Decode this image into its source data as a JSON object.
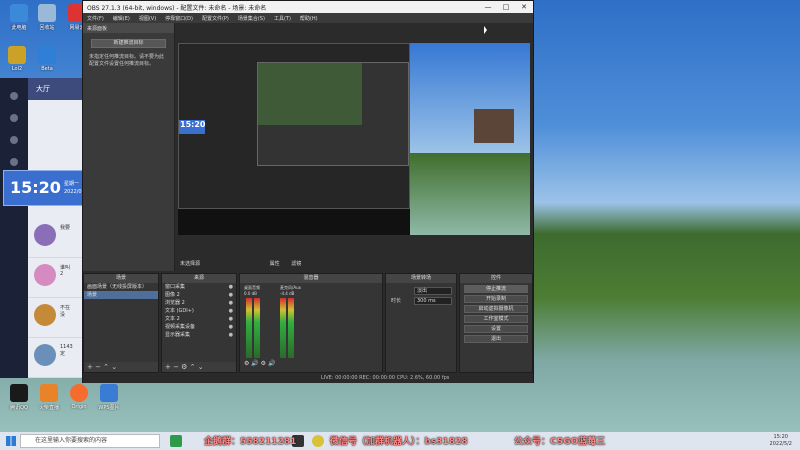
{
  "desktop_icons": [
    {
      "label": "此电脑",
      "icon": "computer-icon",
      "color": "#3b8ad9"
    },
    {
      "label": "回收站",
      "icon": "recycle-bin-icon",
      "color": "#9ab8d8"
    },
    {
      "label": "网易云",
      "icon": "music-app-icon",
      "color": "#d33"
    },
    {
      "label": "Lol2",
      "icon": "game-icon",
      "color": "#c9a227"
    },
    {
      "label": "Beta",
      "icon": "app-icon",
      "color": "#2f7fd6"
    }
  ],
  "bottom_icons": [
    {
      "label": "腾讯QQ",
      "icon": "qq-icon",
      "color": "#1a1a1a"
    },
    {
      "label": "火柴直播",
      "icon": "live-app-icon",
      "color": "#e8832a"
    },
    {
      "label": "Origin",
      "icon": "origin-icon",
      "color": "#f56c2d"
    },
    {
      "label": "WPS图片",
      "icon": "wps-icon",
      "color": "#3a7bd5"
    }
  ],
  "chat_app": {
    "header": "大厅",
    "items": [
      {
        "name": "我要",
        "sub": "2022/05/02"
      },
      {
        "name": "谁叫",
        "sub": "2"
      },
      {
        "name": "不在",
        "sub": "没"
      },
      {
        "name": "1143",
        "sub": "定"
      }
    ]
  },
  "clock": {
    "time": "15:20",
    "weekday": "星期一",
    "date": "2022/05/02"
  },
  "obs": {
    "title": "OBS 27.1.3 (64-bit, windows) - 配置文件: 未命名 - 场景: 未命名",
    "window_controls": [
      "—",
      "□",
      "✕"
    ],
    "menu": [
      "文件(F)",
      "编辑(E)",
      "视图(V)",
      "停靠窗口(D)",
      "配置文件(P)",
      "场景集合(S)",
      "工具(T)",
      "帮助(H)"
    ],
    "left_dock": {
      "header": "来源面板",
      "button": "新建推流目标",
      "text": "未指定任何推流目标。请不要为此配置文件设置任何推流目标。"
    },
    "preview_clock": "15:20",
    "source_bar": {
      "label": "未选择源",
      "properties": "属性",
      "filters": "滤镜"
    },
    "docks": {
      "scenes": {
        "title": "场景",
        "items": [
          "画面场景（无线投屏版本）",
          "场景"
        ],
        "selected": 1
      },
      "sources": {
        "title": "来源",
        "items": [
          "窗口采集",
          "图像 2",
          "浏览器 2",
          "文本 (GDI+)",
          "文本 2",
          "视频采集设备",
          "显示器采集"
        ]
      },
      "mixer": {
        "title": "混音器",
        "channels": [
          {
            "name": "桌面音频",
            "db": "0.0 dB"
          },
          {
            "name": "麦克风/Aux",
            "db": "-4.4 dB"
          }
        ]
      },
      "transitions": {
        "title": "场景转场",
        "type_label": "淡出",
        "duration_label": "时长",
        "duration_value": "300 ms"
      },
      "controls": {
        "title": "控件",
        "buttons": [
          "停止推流",
          "开始录制",
          "启动虚拟摄像机",
          "工作室模式",
          "设置",
          "退出"
        ]
      }
    },
    "status": "LIVE: 00:00:00   REC: 00:00:00   CPU: 2.6%, 60.00 fps"
  },
  "taskbar": {
    "search_placeholder": "在这里输入你要搜索的内容",
    "banner_1": "企鹅群：558211281",
    "banner_2": "微信号（加群机器人）：bs31828",
    "banner_3": "公众号：CSGO蓝莓三",
    "time": "15:20",
    "date": "2022/5/2"
  },
  "colors": {
    "obs_bg": "#2b2b2b",
    "accent": "#3a6fcf",
    "banner": "#ff8a8a"
  }
}
